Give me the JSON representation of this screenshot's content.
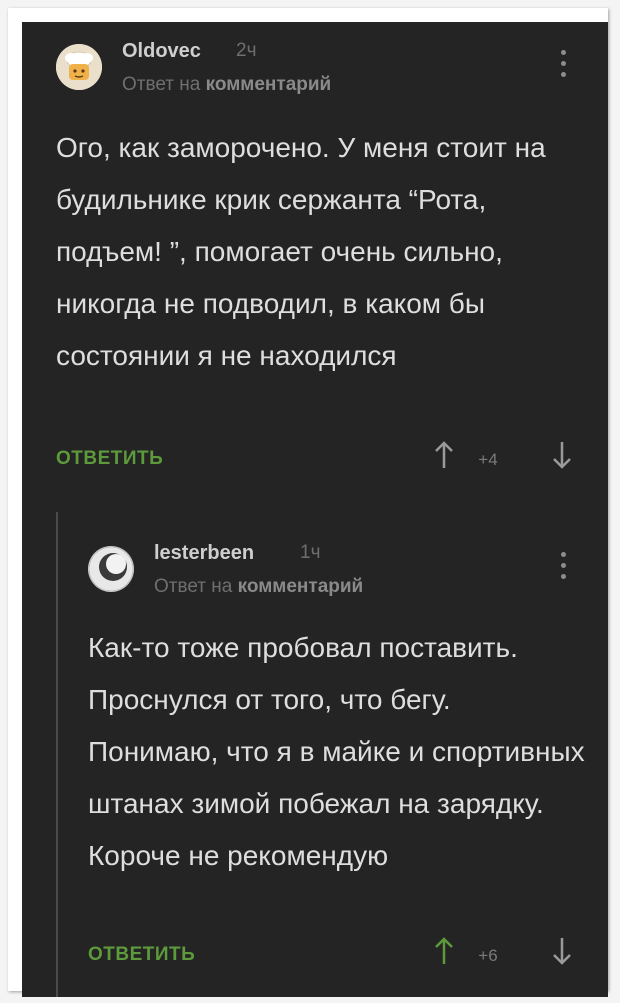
{
  "comments": [
    {
      "author": "Oldovec",
      "time": "2ч",
      "reply_prefix": "Ответ на",
      "reply_target": "комментарий",
      "text": "Ого, как заморочено. У меня стоит на будильнике крик сержанта “Рота, подъем!  ”, помогает очень сильно, никогда не подводил, в каком бы состоянии я не находился",
      "reply_label": "ОТВЕТИТЬ",
      "score": "+4",
      "upvoted": false
    },
    {
      "author": "lesterbeen",
      "time": "1ч",
      "reply_prefix": "Ответ на",
      "reply_target": "комментарий",
      "text": "Как-то тоже пробовал поставить. Проснулся от того, что бегу. Понимаю, что я в майке и спортивных штанах зимой побежал на зарядку. Короче не рекомендую",
      "reply_label": "ОТВЕТИТЬ",
      "score": "+6",
      "upvoted": true
    }
  ],
  "colors": {
    "background": "#242424",
    "text": "#dedede",
    "muted": "#6f6f6f",
    "accent_green": "#5d9a3c",
    "vote_neutral": "#9a9a9a"
  },
  "icons": {
    "upvote": "arrow-up-icon",
    "downvote": "arrow-down-icon",
    "menu": "vertical-dots-icon"
  }
}
